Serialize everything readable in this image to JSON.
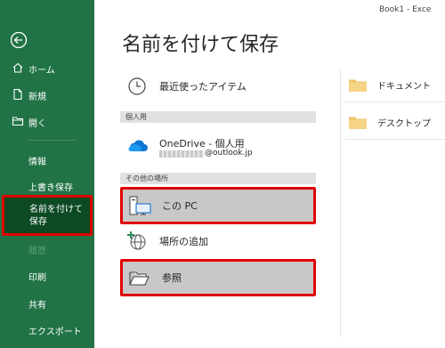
{
  "window": {
    "doc_title": "Book1 - Exce"
  },
  "sidebar": {
    "home_label": "ホーム",
    "new_label": "新規",
    "open_label": "開く",
    "info_label": "情報",
    "save_label": "上書き保存",
    "save_as_label": "名前を付けて保存",
    "history_label": "履歴",
    "print_label": "印刷",
    "share_label": "共有",
    "export_label": "エクスポート"
  },
  "main": {
    "title": "名前を付けて保存",
    "recent_label": "最近使ったアイテム",
    "personal_header": "個人用",
    "onedrive_label": "OneDrive - 個人用",
    "onedrive_account": "@outlook.jp",
    "other_header": "その他の場所",
    "this_pc_label": "この PC",
    "add_place_label": "場所の追加",
    "browse_label": "参照"
  },
  "folders": [
    {
      "name": "ドキュメント"
    },
    {
      "name": "デスクトップ"
    }
  ],
  "colors": {
    "sidebar": "#217346",
    "sidebar_active": "#0c4a24",
    "highlight": "#e00000",
    "folder": "#f1c56a"
  }
}
